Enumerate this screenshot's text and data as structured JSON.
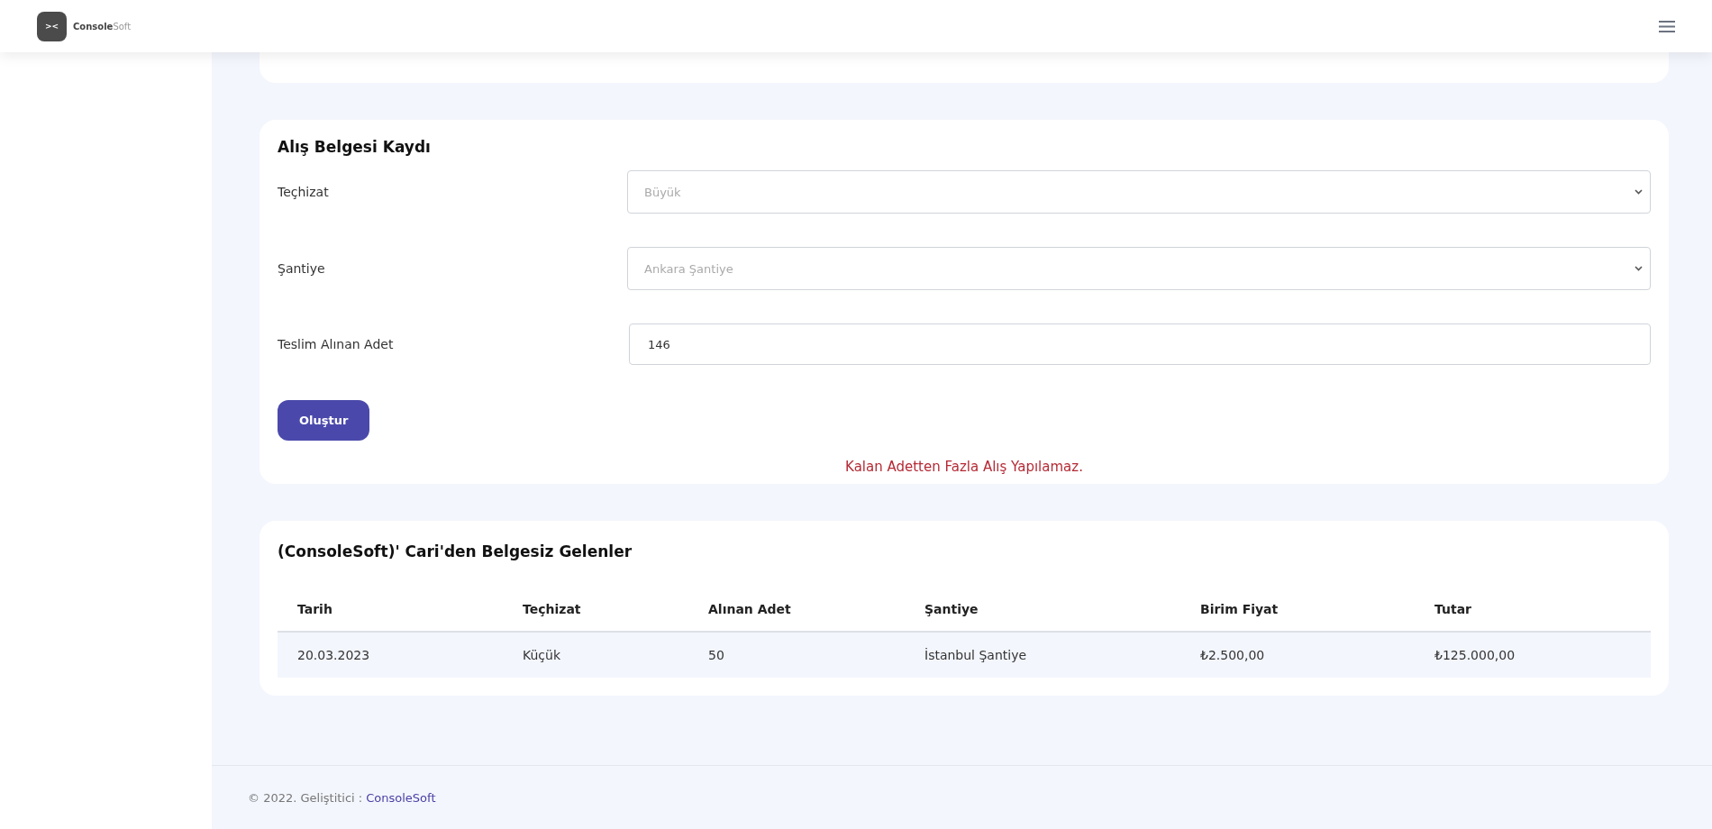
{
  "header": {
    "logo_mark": "><",
    "brand": "**Console**Soft"
  },
  "form": {
    "title": "Alış Belgesi Kaydı",
    "fields": [
      {
        "kind": "select",
        "label": "Teçhizat",
        "placeholder": "Büyük"
      },
      {
        "kind": "select",
        "label": "Şantiye",
        "placeholder": "Ankara Şantiye"
      },
      {
        "kind": "input",
        "label": "Teslim Alınan Adet",
        "value": "146"
      }
    ],
    "submit": "Oluştur",
    "error": "Kalan Adetten Fazla Alış Yapılamaz."
  },
  "table": {
    "title": "(ConsoleSoft)' Cari'den Belgesiz Gelenler",
    "columns": [
      "Tarih",
      "Teçhizat",
      "Alınan Adet",
      "Şantiye",
      "Birim Fiyat",
      "Tutar"
    ],
    "rows": [
      [
        "20.03.2023",
        "Küçük",
        "50",
        "İstanbul Şantiye",
        "₺2.500,00",
        "₺125.000,00"
      ]
    ]
  },
  "footer": {
    "text": "© 2022. Geliştitici :",
    "link": "ConsoleSoft"
  }
}
